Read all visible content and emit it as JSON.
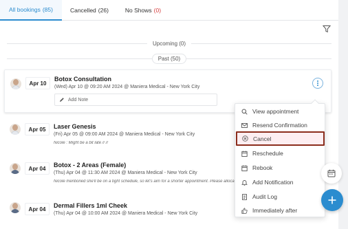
{
  "tabs": [
    {
      "label": "All bookings",
      "count": "(85)"
    },
    {
      "label": "Cancelled",
      "count": "(26)"
    },
    {
      "label": "No Shows",
      "count": "(0)"
    }
  ],
  "sections": {
    "upcoming": "Upcoming (0)",
    "past": "Past (50)"
  },
  "bookings": [
    {
      "date": "Apr 10",
      "title": "Botox Consultation",
      "details": "(Wed) Apr 10 @ 09:20 AM 2024 @ Maniera Medical - New York City",
      "add_note": "Add Note"
    },
    {
      "date": "Apr 05",
      "title": "Laser Genesis",
      "details": "(Fri) Apr 05 @ 09:00 AM 2024 @ Maniera Medical - New York City",
      "note": "Nicole : Might be a bit late // //"
    },
    {
      "date": "Apr 04",
      "title": "Botox - 2 Areas (Female)",
      "details": "(Thu) Apr 04 @ 11:30 AM 2024 @ Maniera Medical - New York City",
      "note": "Nicole mentioned she'll be on a tight schedule, so let's aim for a shorter appointment. Please allocate"
    },
    {
      "date": "Apr 04",
      "title": "Dermal Fillers 1ml Cheek",
      "details": "(Thu) Apr 04 @ 10:00 AM 2024 @ Maniera Medical - New York City"
    }
  ],
  "menu": {
    "items": [
      {
        "label": "View appointment",
        "icon": "search-icon"
      },
      {
        "label": "Resend Confirmation",
        "icon": "envelope-icon"
      },
      {
        "label": "Cancel",
        "icon": "cancel-circle-icon"
      },
      {
        "label": "Reschedule",
        "icon": "calendar-icon"
      },
      {
        "label": "Rebook",
        "icon": "calendar-icon"
      },
      {
        "label": "Add Notification",
        "icon": "bell-icon"
      },
      {
        "label": "Audit Log",
        "icon": "document-icon"
      },
      {
        "label": "Immediately after",
        "icon": "thumbs-up-icon"
      }
    ]
  },
  "colors": {
    "accent": "#2b8ccf",
    "danger": "#d43a3a",
    "highlight_border": "#8b2c1c"
  }
}
